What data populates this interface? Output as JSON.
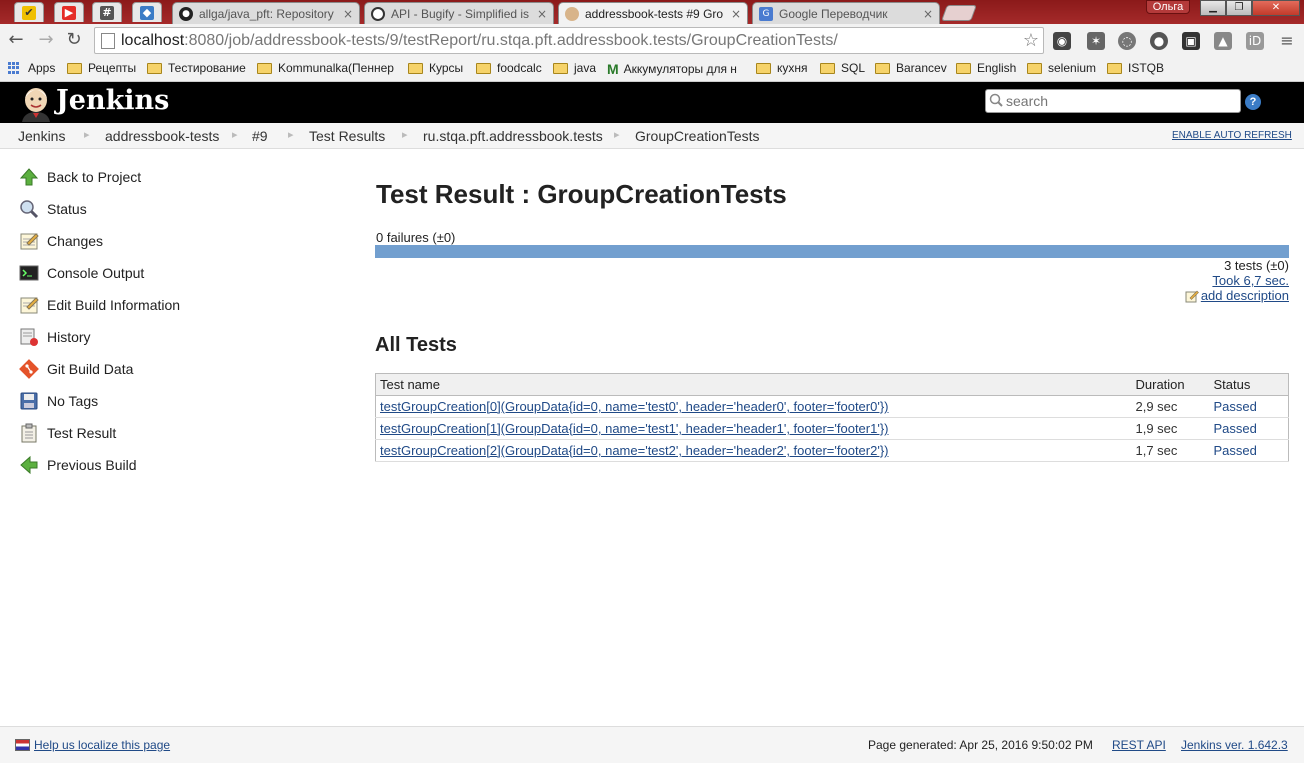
{
  "browser": {
    "tabs": [
      {
        "title": "allga/java_pft: Repository",
        "icon": "github-icon"
      },
      {
        "title": "API - Bugify - Simplified is",
        "icon": "bugify-icon"
      },
      {
        "title": "addressbook-tests #9 Gro",
        "icon": "jenkins-icon"
      },
      {
        "title": "Google Переводчик",
        "icon": "google-translate-icon"
      }
    ],
    "user": "Ольга",
    "close_glyph": "×",
    "url_host": "localhost",
    "url_path": ":8080/job/addressbook-tests/9/testReport/ru.stqa.pft.addressbook.tests/GroupCreationTests/"
  },
  "bookmarks": [
    "Apps",
    "Рецепты",
    "Тестирование",
    "Kommunalka(Пеннер",
    "Курсы",
    "foodcalc",
    "java",
    "Аккумуляторы для н",
    "кухня",
    "SQL",
    "Barancev",
    "English",
    "selenium",
    "ISTQB"
  ],
  "jenkins": {
    "title": "Jenkins",
    "search_placeholder": "search",
    "help": "?",
    "auto_refresh": "ENABLE AUTO REFRESH"
  },
  "breadcrumb": [
    "Jenkins",
    "addressbook-tests",
    "#9",
    "Test Results",
    "ru.stqa.pft.addressbook.tests",
    "GroupCreationTests"
  ],
  "sidepanel": [
    "Back to Project",
    "Status",
    "Changes",
    "Console Output",
    "Edit Build Information",
    "History",
    "Git Build Data",
    "No Tags",
    "Test Result",
    "Previous Build"
  ],
  "main": {
    "title": "Test Result : GroupCreationTests",
    "failures": "0 failures (±0)",
    "pass_fraction": 1.0,
    "tests_count": "3 tests (±0)",
    "took": "Took 6,7 sec.",
    "add_description": "add description",
    "all_tests_heading": "All Tests",
    "table": {
      "headers": [
        "Test name",
        "Duration",
        "Status"
      ],
      "rows": [
        {
          "name": "testGroupCreation[0](GroupData{id=0, name='test0', header='header0', footer='footer0'})",
          "duration": "2,9 sec",
          "status": "Passed"
        },
        {
          "name": "testGroupCreation[1](GroupData{id=0, name='test1', header='header1', footer='footer1'})",
          "duration": "1,9 sec",
          "status": "Passed"
        },
        {
          "name": "testGroupCreation[2](GroupData{id=0, name='test2', header='header2', footer='footer2'})",
          "duration": "1,7 sec",
          "status": "Passed"
        }
      ]
    }
  },
  "footer": {
    "localize": "Help us localize this page",
    "generated": "Page generated: Apr 25, 2016 9:50:02 PM",
    "rest_api": "REST API",
    "version": "Jenkins ver. 1.642.3"
  },
  "colors": {
    "result_bar": "#729fcf",
    "link": "#204a87",
    "header_bg": "#000000"
  }
}
